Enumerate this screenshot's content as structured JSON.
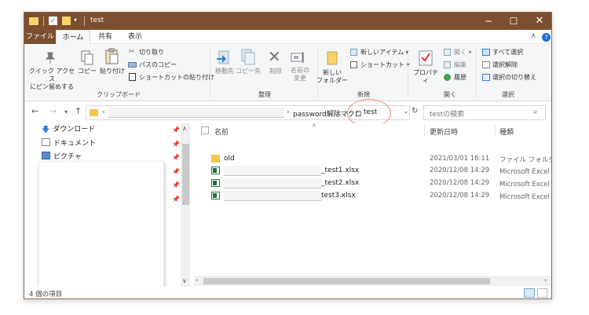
{
  "window": {
    "title": "test"
  },
  "ribbon_tabs": {
    "file": "ファイル",
    "home": "ホーム",
    "share": "共有",
    "view": "表示"
  },
  "ribbon": {
    "pin_quick_access": "クイック アクセス\nにピン留めする",
    "copy": "コピー",
    "paste": "貼り付け",
    "cut": "切り取り",
    "copy_path": "パスのコピー",
    "paste_shortcut": "ショートカットの貼り付け",
    "clipboard_group": "クリップボード",
    "move_to": "移動先",
    "copy_to": "コピー先",
    "delete": "削除",
    "rename": "名前の\n変更",
    "organize_group": "整理",
    "new_folder": "新しい\nフォルダー",
    "new_item": "新しいアイテム ▾",
    "shortcut": "ショートカット ▾",
    "new_group": "新規",
    "properties": "プロパティ",
    "open": "開く ▾",
    "edit": "編集",
    "history": "履歴",
    "open_group": "開く",
    "select_all": "すべて選択",
    "select_none": "選択解除",
    "invert_selection": "選択の切り替え",
    "select_group": "選択"
  },
  "address": {
    "overflow": "‹",
    "segments": [
      "password解除マクロ",
      "test"
    ],
    "separator": "›",
    "search_placeholder": "testの検索"
  },
  "nav_pane": {
    "items": [
      {
        "label": "ダウンロード",
        "icon": "download-arrow-icon"
      },
      {
        "label": "ドキュメント",
        "icon": "document-icon"
      },
      {
        "label": "ピクチャ",
        "icon": "picture-icon"
      }
    ]
  },
  "file_list": {
    "headers": {
      "name": "名前",
      "date": "更新日時",
      "type": "種類"
    },
    "rows": [
      {
        "name": "old",
        "date": "2021/03/01 16:11",
        "type": "ファイル フォルダー",
        "kind": "folder"
      },
      {
        "name": "_test1.xlsx",
        "date": "2020/12/08 14:29",
        "type": "Microsoft Excel ワ",
        "kind": "excel"
      },
      {
        "name": "_test2.xlsx",
        "date": "2020/12/08 14:29",
        "type": "Microsoft Excel ワ",
        "kind": "excel"
      },
      {
        "name": "test3.xlsx",
        "date": "2020/12/08 14:29",
        "type": "Microsoft Excel ワ",
        "kind": "excel"
      }
    ]
  },
  "status": {
    "item_count": "4 個の項目"
  },
  "colors": {
    "titlebar": "#7b4f2f",
    "accent_blue": "#1a6fd6",
    "highlight_circle": "#f08a6a",
    "folder": "#f2c94c",
    "excel": "#1e7145"
  }
}
